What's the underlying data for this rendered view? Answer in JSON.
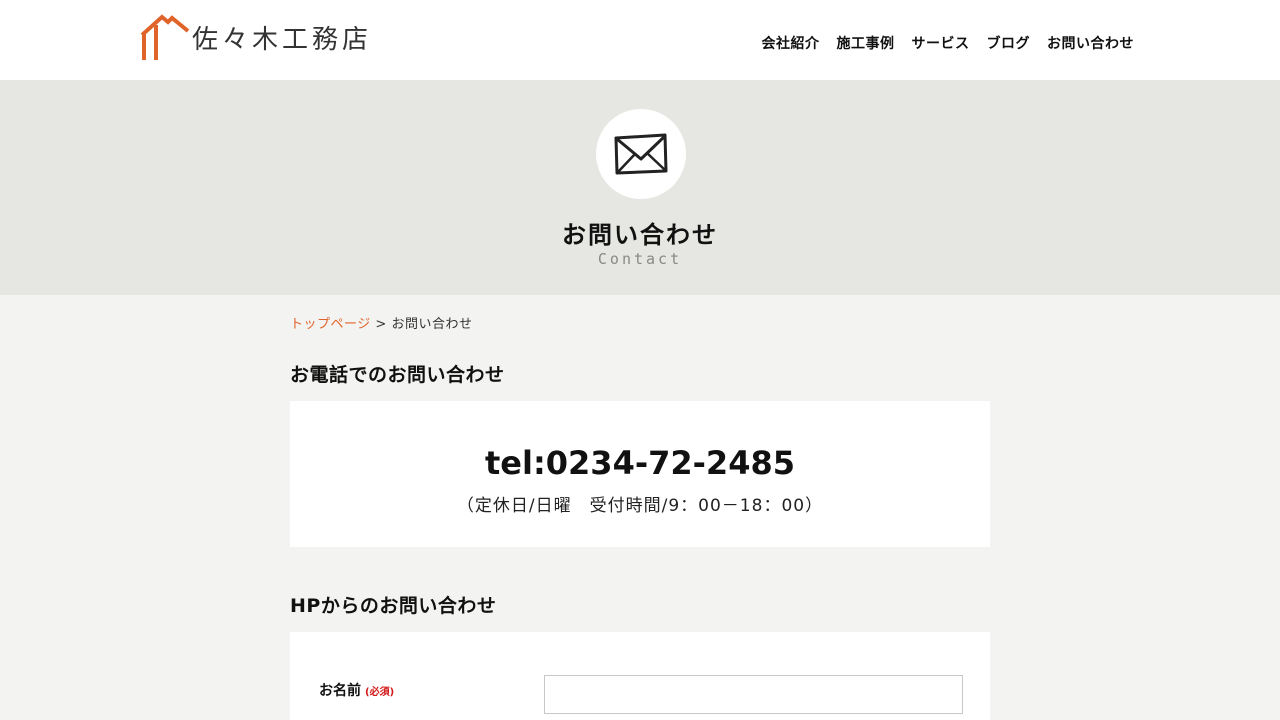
{
  "header": {
    "logo_text": "佐々木工務店",
    "nav": [
      "会社紹介",
      "施工事例",
      "サービス",
      "ブログ",
      "お問い合わせ"
    ]
  },
  "hero": {
    "icon": "envelope-icon",
    "title": "お問い合わせ",
    "subtitle": "Contact"
  },
  "breadcrumb": {
    "home": "トップページ",
    "separator": ">",
    "current": "お問い合わせ"
  },
  "phone_section": {
    "title": "お電話でのお問い合わせ",
    "tel": "tel:0234-72-2485",
    "hours": "（定休日/日曜　受付時間/9：00－18：00）"
  },
  "form_section": {
    "title": "HPからのお問い合わせ",
    "name_label": "お名前",
    "required_label": "(必須)",
    "name_value": "",
    "name_placeholder": ""
  },
  "colors": {
    "accent": "#e0632a",
    "required": "#d21818",
    "hero_bg": "#e6e6e2",
    "page_bg": "#f3f3f1"
  }
}
